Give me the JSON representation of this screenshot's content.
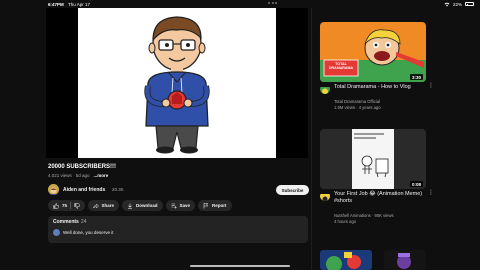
{
  "status_bar": {
    "time": "6:47PM",
    "date": "Thu Apr 17",
    "battery_text": "22%",
    "battery_level": 0.22
  },
  "video": {
    "title": "20000 SUBSCRIBERS!!!",
    "views": "4,021 views",
    "age": "5d ago",
    "more": "...more"
  },
  "channel": {
    "name": "Aiden and friends",
    "subs": "20.3K",
    "subscribe": "Subscribe"
  },
  "actions": {
    "likes": "75",
    "share": "Share",
    "download": "Download",
    "save": "Save",
    "report": "Report"
  },
  "comments": {
    "label": "Comments",
    "count": "24",
    "top_comment": "Well done, you deserve it"
  },
  "recommendations": [
    {
      "title": "Total Dramarama - How to Vlog",
      "channel": "Total Dramarama Official",
      "views": "1.9M views",
      "age": "4 years ago",
      "duration": "3:30",
      "thumb_overlay": "TOTAL DRAMARAMA"
    },
    {
      "title": "Your First Job 😂 (Animation Meme) #shorts",
      "channel": "Nutshell Animations",
      "views": "90K views",
      "age": "4 hours ago",
      "duration": "0:08"
    }
  ],
  "colors": {
    "background": "#0f0f0f",
    "pill": "#272727",
    "subscribe_bg": "#f1f1f1",
    "accent_red": "#e53935"
  }
}
